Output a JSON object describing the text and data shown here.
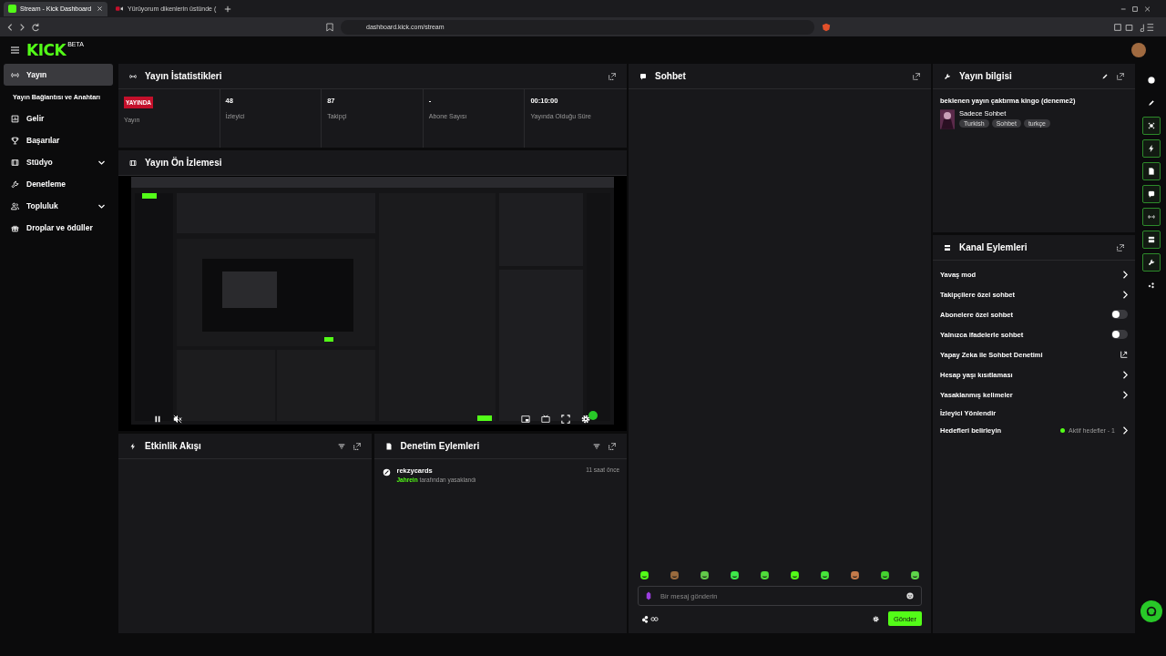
{
  "browser": {
    "tabs": [
      {
        "title": "Stream - Kick Dashboard",
        "selected": true,
        "kind": "kick"
      },
      {
        "title": "Yürüyorum dikenlerin üstünde (",
        "selected": false,
        "kind": "audio"
      }
    ],
    "url": "dashboard.kick.com/stream"
  },
  "header": {
    "logo": "KICK",
    "badge": "BETA"
  },
  "sidebar": {
    "items": [
      {
        "label": "Yayın",
        "selected": true,
        "children": [
          {
            "label": "Yayın Bağlantısı ve Anahtarı",
            "selected": false
          }
        ]
      },
      {
        "label": "Gelir",
        "selected": false
      },
      {
        "label": "Başarılar",
        "selected": false
      },
      {
        "label": "Stüdyo",
        "selected": false,
        "expanded": false
      },
      {
        "label": "Denetleme",
        "selected": false
      },
      {
        "label": "Topluluk",
        "selected": false,
        "expanded": false
      },
      {
        "label": "Droplar ve ödüller",
        "selected": false
      }
    ]
  },
  "stats": {
    "title": "Yayın İstatistikleri",
    "cells": [
      {
        "kind": "badge",
        "value": "YAYINDA",
        "label": "Yayın"
      },
      {
        "kind": "text",
        "value": "48",
        "label": "İzleyici"
      },
      {
        "kind": "text",
        "value": "87",
        "label": "Takipçi"
      },
      {
        "kind": "text",
        "value": "-",
        "label": "Abone Sayısı"
      },
      {
        "kind": "text",
        "value": "00:10:00",
        "label": "Yayında Olduğu Süre"
      }
    ]
  },
  "preview": {
    "title": "Yayın Ön İzlemesi",
    "kind": "picture"
  },
  "events": {
    "title": "Etkinlik Akışı"
  },
  "moderation": {
    "title": "Denetim Eylemleri",
    "entries": [
      {
        "user": "rekzycards",
        "actor": "Jahrein",
        "action": "tarafından yasaklandı",
        "time": "11 saat önce"
      }
    ]
  },
  "chat": {
    "title": "Sohbet",
    "placeholder": "Bir mesaj gönderin",
    "send": "Gönder"
  },
  "stream_info": {
    "title": "Yayın bilgisi",
    "stream_title": "beklenen yayın çaktırma kingo (deneme2)",
    "category": "Sadece Sohbet",
    "tags": [
      "Turkish",
      "Sohbet",
      "turkçe"
    ]
  },
  "channel_actions": {
    "title": "Kanal Eylemleri",
    "items": [
      {
        "label": "Yavaş mod",
        "kind": "chevron"
      },
      {
        "label": "Takipçilere özel sohbet",
        "kind": "chevron"
      },
      {
        "label": "Abonelere özel sohbet",
        "kind": "toggle",
        "on": false
      },
      {
        "label": "Yalnızca ifadelerle sohbet",
        "kind": "toggle",
        "on": false
      },
      {
        "label": "Yapay Zeka ile Sohbet Denetimi",
        "kind": "external"
      },
      {
        "label": "Hesap yaşı kısıtlaması",
        "kind": "chevron"
      },
      {
        "label": "Yasaklanmış kelimeler",
        "kind": "chevron"
      },
      {
        "label": "İzleyici Yönlendir",
        "kind": "plain"
      },
      {
        "label": "Hedefleri belirleyin",
        "kind": "status",
        "status": "Aktif hedefler - 1",
        "color": "#53fc18"
      }
    ]
  },
  "rail": [
    {
      "kind": "info",
      "active": false
    },
    {
      "kind": "pencil",
      "active": false
    },
    {
      "kind": "focus",
      "active": true
    },
    {
      "kind": "bolt",
      "active": true
    },
    {
      "kind": "doc",
      "active": true
    },
    {
      "kind": "chat",
      "active": true
    },
    {
      "kind": "broadcast",
      "active": true
    },
    {
      "kind": "actions",
      "active": true
    },
    {
      "kind": "wrench",
      "active": true
    },
    {
      "kind": "nodes",
      "active": false
    }
  ]
}
